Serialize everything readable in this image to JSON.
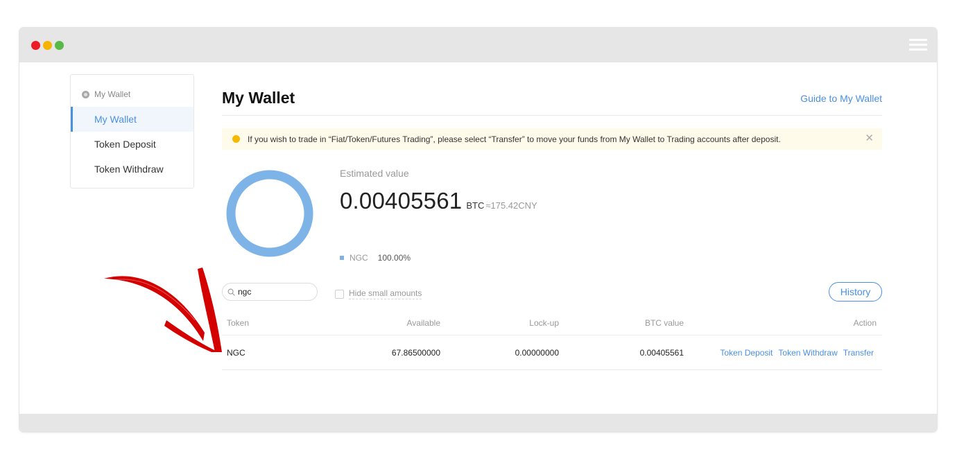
{
  "sidebar": {
    "header": "My Wallet",
    "items": [
      {
        "label": "My Wallet",
        "active": true
      },
      {
        "label": "Token Deposit",
        "active": false
      },
      {
        "label": "Token Withdraw",
        "active": false
      }
    ]
  },
  "main": {
    "title": "My Wallet",
    "guide_link": "Guide to My Wallet",
    "notice": "If you wish to trade in “Fiat/Token/Futures Trading”, please select “Transfer” to move your funds from My Wallet to Trading accounts after deposit.",
    "notice_close": "✕",
    "estimate": {
      "label": "Estimated value",
      "value": "0.00405561",
      "unit": "BTC",
      "fiat": "≈175.42CNY"
    },
    "allocation": [
      {
        "name": "NGC",
        "percent": "100.00%",
        "share": 1.0,
        "color": "#7eb3e8"
      }
    ],
    "search": {
      "value": "ngc"
    },
    "hide_small_label": "Hide small amounts",
    "history_button": "History",
    "table": {
      "columns": [
        "Token",
        "Available",
        "Lock-up",
        "BTC value",
        "Action"
      ],
      "rows": [
        {
          "token": "NGC",
          "available": "67.86500000",
          "lockup": "0.00000000",
          "btc_value": "0.00405561",
          "actions": [
            "Token Deposit",
            "Token Withdraw",
            "Transfer"
          ]
        }
      ]
    }
  },
  "colors": {
    "accent": "#4a90e2",
    "notice_bg": "#fffbeb",
    "notice_dot": "#f6b800",
    "arrow": "#d40000"
  }
}
